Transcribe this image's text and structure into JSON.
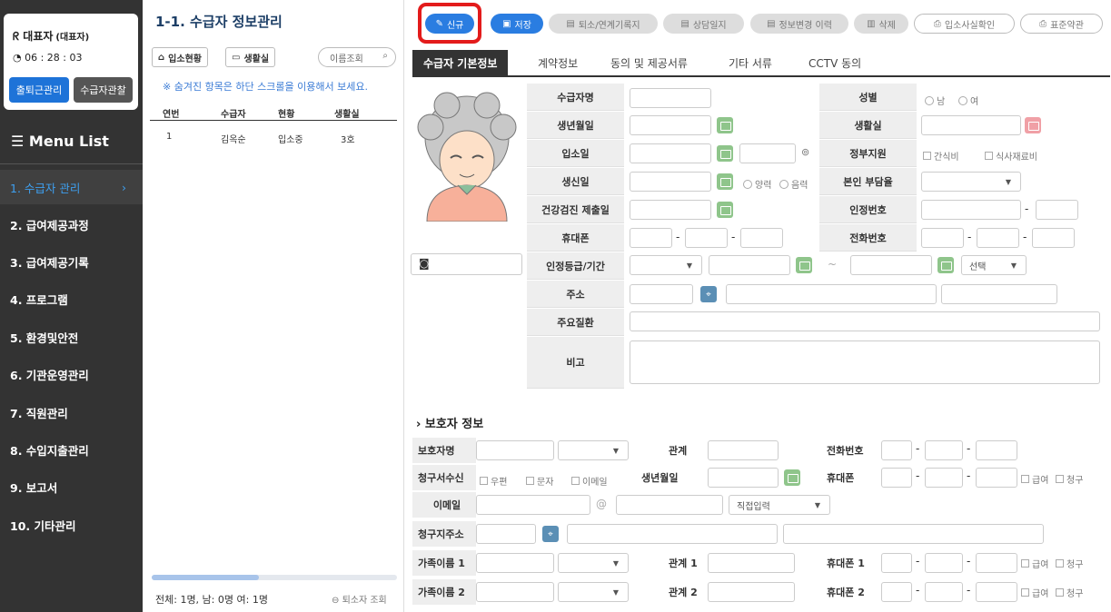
{
  "user": {
    "name": "대표자",
    "role": "(대표자)",
    "time": "06 : 28 : 03",
    "btn_attend": "출퇴근관리",
    "btn_recipient": "수급자관찰"
  },
  "menu": {
    "title": "Menu List",
    "items": [
      "1. 수급자 관리",
      "2. 급여제공과정",
      "3. 급여제공기록",
      "4. 프로그램",
      "5. 환경및안전",
      "6. 기관운영관리",
      "7. 직원관리",
      "8. 수입지출관리",
      "9. 보고서",
      "10. 기타관리"
    ]
  },
  "list": {
    "title": "1-1. 수급자 정보관리",
    "btn_status": "입소현황",
    "btn_room": "생활실",
    "search_placeholder": "이름조회",
    "note": "※ 숨겨진 항목은 하단 스크롤을 이용해서 보세요.",
    "headers": [
      "연번",
      "수급자",
      "현황",
      "생활실"
    ],
    "rows": [
      [
        "1",
        "김옥순",
        "입소중",
        "3호"
      ]
    ],
    "footer": "전체: 1명, 남: 0명 여: 1명",
    "footer_btn": "퇴소자 조회"
  },
  "toolbar": {
    "new": "신규",
    "save": "저장",
    "leave": "퇴소/연계기록지",
    "consult": "상담일지",
    "history": "정보변경 이력",
    "delete": "삭제",
    "admission": "입소사실확인",
    "terms": "표준약관"
  },
  "tabs": [
    "수급자 기본정보",
    "계약정보",
    "동의 및 제공서류",
    "기타 서류",
    "CCTV 동의"
  ],
  "form": {
    "name": "수급자명",
    "gender": "성별",
    "male": "남",
    "female": "여",
    "birth": "생년월일",
    "room": "생활실",
    "admission": "입소일",
    "support": "정부지원",
    "snack": "간식비",
    "meal": "식사재료비",
    "birthday": "생신일",
    "solar": "양력",
    "lunar": "음력",
    "burden": "본인 부담율",
    "checkup": "건강검진 제출일",
    "cert_no": "인정번호",
    "mobile": "휴대폰",
    "phone": "전화번호",
    "grade": "인정등급/기간",
    "grade_select": "선택",
    "tilde": "~",
    "address": "주소",
    "disease": "주요질환",
    "remarks": "비고"
  },
  "guardian": {
    "section": "보호자 정보",
    "name": "보호자명",
    "relation": "관계",
    "phone": "전화번호",
    "bill": "청구서수신",
    "post": "우편",
    "sms": "문자",
    "email_opt": "이메일",
    "birth": "생년월일",
    "mobile": "휴대폰",
    "pay": "급여",
    "claim": "청구",
    "email": "이메일",
    "at": "@",
    "direct": "직접입력",
    "bill_addr": "청구지주소",
    "family1": "가족이름 1",
    "rel1": "관계 1",
    "mob1": "휴대폰 1",
    "family2": "가족이름 2",
    "rel2": "관계 2",
    "mob2": "휴대폰 2"
  }
}
